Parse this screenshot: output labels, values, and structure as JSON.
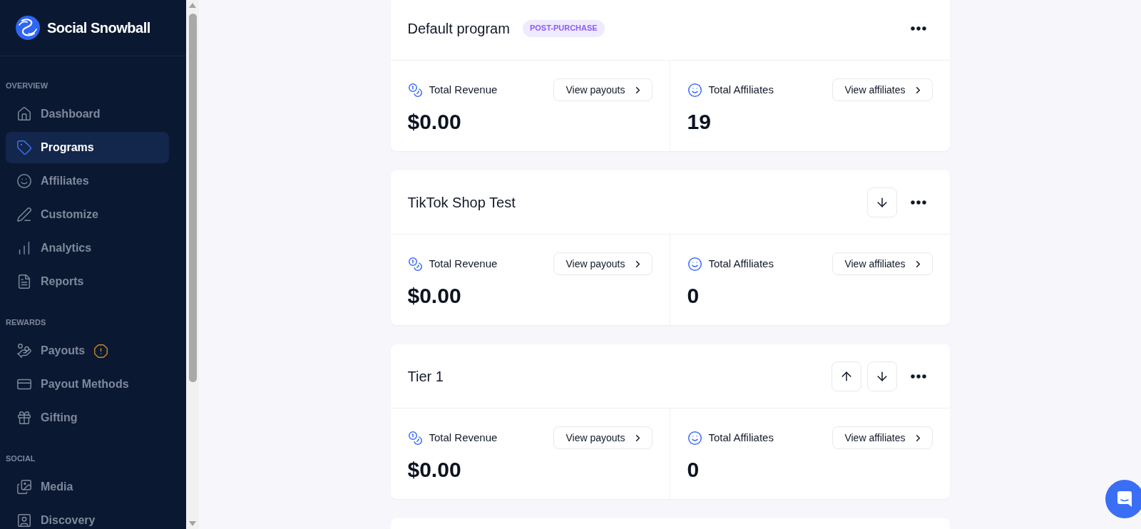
{
  "sidebar": {
    "brand": "Social Snowball",
    "sections": [
      {
        "heading": "OVERVIEW",
        "items": [
          {
            "label": "Dashboard",
            "selected": false,
            "warning": false
          },
          {
            "label": "Programs",
            "selected": true,
            "warning": false
          },
          {
            "label": "Affiliates",
            "selected": false,
            "warning": false
          },
          {
            "label": "Customize",
            "selected": false,
            "warning": false
          },
          {
            "label": "Analytics",
            "selected": false,
            "warning": false
          },
          {
            "label": "Reports",
            "selected": false,
            "warning": false
          }
        ]
      },
      {
        "heading": "REWARDS",
        "items": [
          {
            "label": "Payouts",
            "selected": false,
            "warning": true
          },
          {
            "label": "Payout Methods",
            "selected": false,
            "warning": false
          },
          {
            "label": "Gifting",
            "selected": false,
            "warning": false
          }
        ]
      },
      {
        "heading": "SOCIAL",
        "items": [
          {
            "label": "Media",
            "selected": false,
            "warning": false
          },
          {
            "label": "Discovery",
            "selected": false,
            "warning": false
          }
        ]
      }
    ]
  },
  "programs": [
    {
      "name": "Default program",
      "badge": "POST-PURCHASE",
      "can_move_up": false,
      "can_move_down": false,
      "stats": [
        {
          "kind": "revenue",
          "label": "Total Revenue",
          "value": "$0.00",
          "action": "View payouts"
        },
        {
          "kind": "affiliates",
          "label": "Total Affiliates",
          "value": "19",
          "action": "View affiliates"
        }
      ]
    },
    {
      "name": "TikTok Shop Test",
      "can_move_up": false,
      "can_move_down": true,
      "stats": [
        {
          "kind": "revenue",
          "label": "Total Revenue",
          "value": "$0.00",
          "action": "View payouts"
        },
        {
          "kind": "affiliates",
          "label": "Total Affiliates",
          "value": "0",
          "action": "View affiliates"
        }
      ]
    },
    {
      "name": "Tier 1",
      "can_move_up": true,
      "can_move_down": true,
      "stats": [
        {
          "kind": "revenue",
          "label": "Total Revenue",
          "value": "$0.00",
          "action": "View payouts"
        },
        {
          "kind": "affiliates",
          "label": "Total Affiliates",
          "value": "0",
          "action": "View affiliates"
        }
      ]
    }
  ]
}
